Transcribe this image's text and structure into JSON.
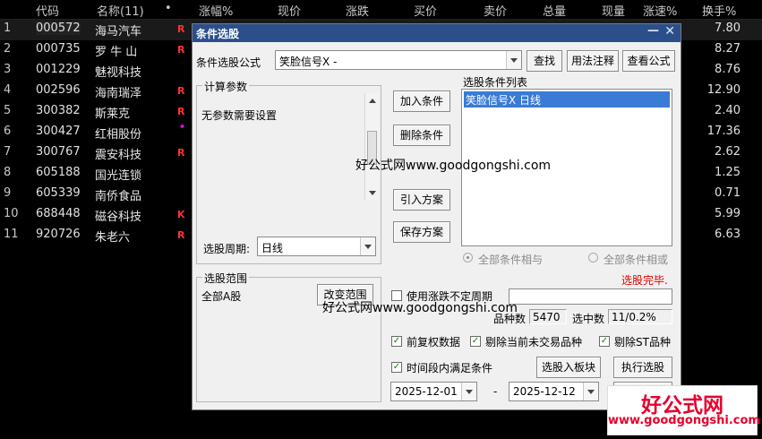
{
  "table": {
    "headers": [
      "代码",
      "名称(11)",
      "•",
      "涨幅%",
      "现价",
      "涨跌",
      "买价",
      "卖价",
      "总量",
      "现量",
      "涨速%",
      "换手%"
    ],
    "rows": [
      {
        "idx": "1",
        "code": "000572",
        "name": "海马汽车",
        "flag": "R",
        "turnover": "7.80"
      },
      {
        "idx": "2",
        "code": "000735",
        "name": "罗 牛 山",
        "flag": "R",
        "turnover": "8.27"
      },
      {
        "idx": "3",
        "code": "001229",
        "name": "魅视科技",
        "flag": "",
        "turnover": "8.76"
      },
      {
        "idx": "4",
        "code": "002596",
        "name": "海南瑞泽",
        "flag": "R",
        "turnover": "12.90"
      },
      {
        "idx": "5",
        "code": "300382",
        "name": "斯莱克",
        "flag": "R",
        "turnover": "2.40"
      },
      {
        "idx": "6",
        "code": "300427",
        "name": "红相股份",
        "flag": "•",
        "turnover": "17.36"
      },
      {
        "idx": "7",
        "code": "300767",
        "name": "震安科技",
        "flag": "R",
        "turnover": "2.62"
      },
      {
        "idx": "8",
        "code": "605188",
        "name": "国光连锁",
        "flag": "",
        "turnover": "1.25"
      },
      {
        "idx": "9",
        "code": "605339",
        "name": "南侨食品",
        "flag": "",
        "turnover": "0.71"
      },
      {
        "idx": "10",
        "code": "688448",
        "name": "磁谷科技",
        "flag": "K",
        "turnover": "5.99"
      },
      {
        "idx": "11",
        "code": "920726",
        "name": "朱老六",
        "flag": "R",
        "turnover": "6.63"
      }
    ]
  },
  "dialog": {
    "title": "条件选股",
    "formula_label": "条件选股公式",
    "formula_value": "笑脸信号X  -",
    "btn_find": "查找",
    "btn_usage": "用法注释",
    "btn_view": "查看公式",
    "params_group": "计算参数",
    "params_text": "无参数需要设置",
    "period_label": "选股周期:",
    "period_value": "日线",
    "btn_add": "加入条件",
    "btn_delete": "删除条件",
    "btn_import": "引入方案",
    "btn_save": "保存方案",
    "cond_list_label": "选股条件列表",
    "cond_item": "笑脸信号X  日线",
    "radio_and": "全部条件相与",
    "radio_or": "全部条件相或",
    "status": "选股完毕.",
    "range_group": "选股范围",
    "range_value": "全部A股",
    "btn_change_range": "改变范围",
    "uncertain_period": "使用涨跌不定周期",
    "count_label": "品种数",
    "count_value": "5470",
    "selected_label": "选中数",
    "selected_value": "11/0.2%",
    "chk_fq": "前复权数据",
    "chk_exclude_untraded": "剔除当前未交易品种",
    "chk_exclude_st": "剔除ST品种",
    "chk_period": "时间段内满足条件",
    "btn_to_block": "选股入板块",
    "btn_execute": "执行选股",
    "date_from": "2025-12-01",
    "date_sep": "-",
    "date_to": "2025-12-12"
  },
  "watermarks": {
    "wm1": "好公式网www.goodgongshi.com",
    "wm2": "好公式网www.goodgongshi.com",
    "logo_cn": "好公式网",
    "logo_url": "www.goodgongshi.com"
  },
  "colors": {
    "accent_blue": "#3a7bd5",
    "status_red": "#e00000",
    "title_bar": "#2b4f8a",
    "logo_red": "#e6002d"
  }
}
